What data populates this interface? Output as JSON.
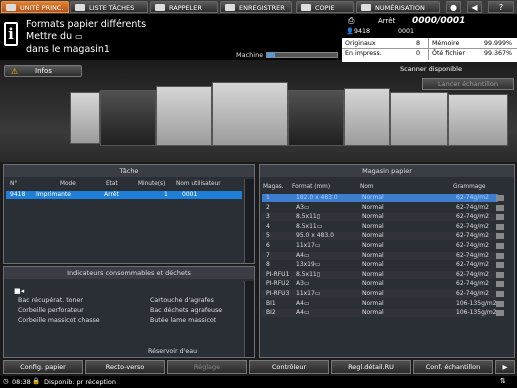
{
  "tabs": {
    "unit": "UNITÉ PRINC.",
    "jobs": "LISTE TÂCHES",
    "recall": "RAPPELER",
    "save": "ENREGISTRER",
    "copy": "COPIE",
    "scan": "NUMÉRISATION"
  },
  "message": {
    "line1": "Formats papier différents",
    "line2": "Mettre du",
    "line3": "dans le magasin1",
    "machine_label": "Machine"
  },
  "status": {
    "state": "Arrêt",
    "counter": "0000/0001",
    "job_id": "9418",
    "job_count": "0001",
    "originals_label": "Originaux",
    "originals_value": "8",
    "memory_label": "Mémoire",
    "memory_value": "99.999%",
    "printing_label": "En impress.",
    "printing_value": "0",
    "hdd_label": "Ôté fichier",
    "hdd_value": "99.367%",
    "scanner": "Scanner disponible",
    "sample_btn": "Lancer échantillon"
  },
  "info_button": "Infos",
  "jobs": {
    "title": "Tâche",
    "columns": [
      "N°",
      "Mode",
      "Etat",
      "Minute(s)",
      "Nom utilisateur"
    ],
    "rows": [
      [
        "9418",
        "Imprimante",
        "Arrêt",
        "1",
        "0001"
      ]
    ]
  },
  "consumables": {
    "title": "Indicateurs consommables et déchets",
    "items_left": [
      "Bac récupérat. toner",
      "Corbeille perforateur",
      "Corbeille massicot chasse"
    ],
    "items_right": [
      "Cartouche d'agrafes",
      "Bac déchets agrafeuse",
      "Butée lame massicot"
    ],
    "water": "Réservoir d'eau"
  },
  "paper": {
    "title": "Magasin papier",
    "columns": [
      "Magas.",
      "Format (mm)",
      "Nom",
      "Grammage"
    ],
    "rows": [
      [
        "1",
        "182.0 x 483.0",
        "Normal",
        "62-74g/m2"
      ],
      [
        "2",
        "A3▭",
        "Normal",
        "62-74g/m2"
      ],
      [
        "3",
        "8.5x11▯",
        "Normal",
        "62-74g/m2"
      ],
      [
        "4",
        "8.5x11▭",
        "Normal",
        "62-74g/m2"
      ],
      [
        "5",
        "95.0 x 483.0",
        "Normal",
        "62-74g/m2"
      ],
      [
        "6",
        "11x17▭",
        "Normal",
        "62-74g/m2"
      ],
      [
        "7",
        "A4▭",
        "Normal",
        "62-74g/m2"
      ],
      [
        "8",
        "13x19▭",
        "Normal",
        "62-74g/m2"
      ],
      [
        "PI-RFU1",
        "8.5x11▯",
        "Normal",
        "62-74g/m2"
      ],
      [
        "PI-RFU2",
        "A3▭",
        "Normal",
        "62-74g/m2"
      ],
      [
        "PI-RFU3",
        "11x17▭",
        "Normal",
        "62-74g/m2"
      ],
      [
        "BI1",
        "A4▭",
        "Normal",
        "106-135g/m2"
      ],
      [
        "BI2",
        "A4▭",
        "Normal",
        "106-135g/m2"
      ]
    ]
  },
  "bottom": {
    "paper_settings": "Config. papier",
    "duplex": "Recto-verso",
    "adjust": "Réglage",
    "controller": "Contrôleur",
    "ru_settings": "Regl.détail.RU",
    "sample_settings": "Conf. échantillon"
  },
  "footer": {
    "time": "08:38",
    "status": "Disponib. pr réception"
  },
  "colors": {
    "accent": "#e07a2a",
    "selected": "#1f7fd6"
  }
}
